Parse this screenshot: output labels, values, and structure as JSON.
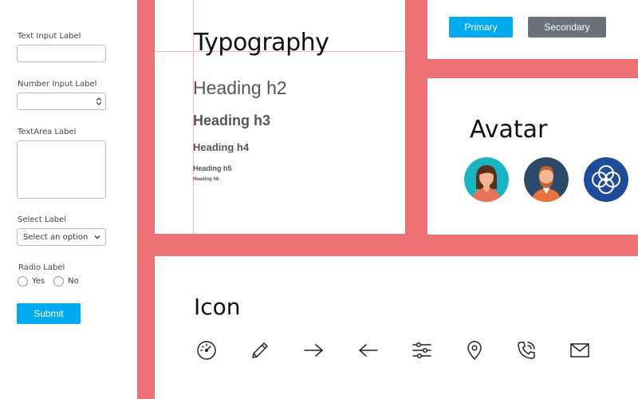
{
  "form": {
    "text_input_label": "Text Input Label",
    "text_input_value": "",
    "number_input_label": "Number Input Label",
    "number_input_value": "",
    "textarea_label": "TextArea Label",
    "textarea_value": "",
    "select_label": "Select Label",
    "select_value": "Select an option",
    "radio_label": "Radio Label",
    "radio_options": [
      "Yes",
      "No"
    ],
    "submit_label": "Submit"
  },
  "buttons": {
    "primary_label": "Primary",
    "secondary_label": "Secondary",
    "primary_color": "#00aaee",
    "secondary_color": "#6a7178"
  },
  "typography": {
    "title": "Typography",
    "h2": "Heading h2",
    "h3": "Heading h3",
    "h4": "Heading h4",
    "h5": "Heading h5",
    "h6": "Heading h6"
  },
  "avatar": {
    "title": "Avatar",
    "items": [
      "woman-avatar",
      "bearded-man-avatar",
      "flower-logo-avatar"
    ]
  },
  "icon_section": {
    "title": "Icon",
    "icons": [
      "speedometer-icon",
      "pencil-icon",
      "arrow-right-icon",
      "arrow-left-icon",
      "sliders-icon",
      "location-pin-icon",
      "phone-call-icon",
      "mail-icon"
    ]
  },
  "colors": {
    "background": "#ec7074",
    "accent": "#00aaee"
  }
}
